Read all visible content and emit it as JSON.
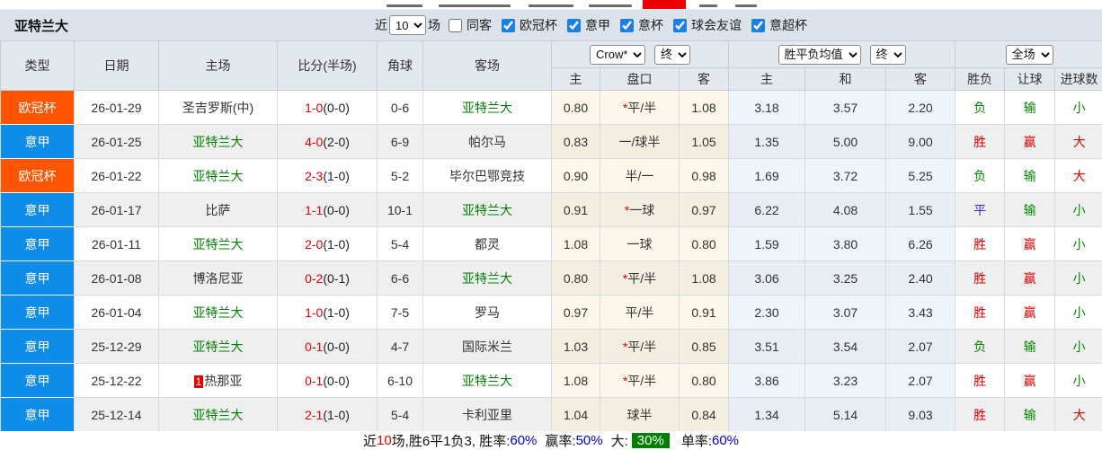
{
  "focus_team": "亚特兰大",
  "accent_colors": {
    "league_cup": "#ff5500",
    "league_serie_a": "#0d8ce8",
    "win_red": "#dd0000",
    "lose_green": "#008800",
    "draw_blue": "#2b2bd6",
    "team_green": "#008000",
    "highlight_green_bg": "#008000",
    "clipped_red_block": "#ef0000"
  },
  "toolbar": {
    "team_title": "亚特兰大",
    "recent_label": "近",
    "matches_count": "10",
    "matches_label": "场",
    "same_venue_label": "同客",
    "same_venue_checked": false,
    "filters": [
      {
        "label": "欧冠杯",
        "checked": true
      },
      {
        "label": "意甲",
        "checked": true
      },
      {
        "label": "意杯",
        "checked": true
      },
      {
        "label": "球会友谊",
        "checked": true
      },
      {
        "label": "意超杯",
        "checked": true
      }
    ]
  },
  "table": {
    "headers_left": [
      "类型",
      "日期",
      "主场",
      "比分(半场)",
      "角球",
      "客场"
    ],
    "odds_group": {
      "bookmaker": "Crow*",
      "state": "终"
    },
    "avg_group": {
      "name": "胜平负均值",
      "state": "终"
    },
    "result_group": {
      "scope": "全场"
    },
    "sub_headers": [
      "主",
      "盘口",
      "客",
      "主",
      "和",
      "客",
      "胜负",
      "让球",
      "进球数"
    ],
    "rows": [
      {
        "league": "欧冠杯",
        "date": "26-01-29",
        "home": "圣吉罗斯(中)",
        "score": "1-0",
        "half": "(0-0)",
        "corners": "0-6",
        "away": "亚特兰大",
        "odds_home": "0.80",
        "handicap_star": "*",
        "handicap": "平/半",
        "odds_away": "1.08",
        "avg_win": "3.18",
        "avg_draw": "3.57",
        "avg_lose": "2.20",
        "outcome": "负",
        "handicap_result": "输",
        "goals": "小"
      },
      {
        "league": "意甲",
        "date": "26-01-25",
        "home": "亚特兰大",
        "score": "4-0",
        "half": "(2-0)",
        "corners": "6-9",
        "away": "帕尔马",
        "odds_home": "0.83",
        "handicap": "一/球半",
        "odds_away": "1.05",
        "avg_win": "1.35",
        "avg_draw": "5.00",
        "avg_lose": "9.00",
        "outcome": "胜",
        "handicap_result": "赢",
        "goals": "大"
      },
      {
        "league": "欧冠杯",
        "date": "26-01-22",
        "home": "亚特兰大",
        "score": "2-3",
        "half": "(1-0)",
        "corners": "5-2",
        "away": "毕尔巴鄂竞技",
        "odds_home": "0.90",
        "handicap": "半/一",
        "odds_away": "0.98",
        "avg_win": "1.69",
        "avg_draw": "3.72",
        "avg_lose": "5.25",
        "outcome": "负",
        "handicap_result": "输",
        "goals": "大"
      },
      {
        "league": "意甲",
        "date": "26-01-17",
        "home": "比萨",
        "score": "1-1",
        "half": "(0-0)",
        "corners": "10-1",
        "away": "亚特兰大",
        "odds_home": "0.91",
        "handicap_star": "*",
        "handicap": "一球",
        "odds_away": "0.97",
        "avg_win": "6.22",
        "avg_draw": "4.08",
        "avg_lose": "1.55",
        "outcome": "平",
        "handicap_result": "输",
        "goals": "小"
      },
      {
        "league": "意甲",
        "date": "26-01-11",
        "home": "亚特兰大",
        "score": "2-0",
        "half": "(1-0)",
        "corners": "5-4",
        "away": "都灵",
        "odds_home": "1.08",
        "handicap": "一球",
        "odds_away": "0.80",
        "avg_win": "1.59",
        "avg_draw": "3.80",
        "avg_lose": "6.26",
        "outcome": "胜",
        "handicap_result": "赢",
        "goals": "小"
      },
      {
        "league": "意甲",
        "date": "26-01-08",
        "home": "博洛尼亚",
        "score": "0-2",
        "half": "(0-1)",
        "corners": "6-6",
        "away": "亚特兰大",
        "odds_home": "0.80",
        "handicap_star": "*",
        "handicap": "平/半",
        "odds_away": "1.08",
        "avg_win": "3.06",
        "avg_draw": "3.25",
        "avg_lose": "2.40",
        "outcome": "胜",
        "handicap_result": "赢",
        "goals": "小"
      },
      {
        "league": "意甲",
        "date": "26-01-04",
        "home": "亚特兰大",
        "score": "1-0",
        "half": "(1-0)",
        "corners": "7-5",
        "away": "罗马",
        "odds_home": "0.97",
        "handicap": "平/半",
        "odds_away": "0.91",
        "avg_win": "2.30",
        "avg_draw": "3.07",
        "avg_lose": "3.43",
        "outcome": "胜",
        "handicap_result": "赢",
        "goals": "小"
      },
      {
        "league": "意甲",
        "date": "25-12-29",
        "home": "亚特兰大",
        "score": "0-1",
        "half": "(0-0)",
        "corners": "4-7",
        "away": "国际米兰",
        "odds_home": "1.03",
        "handicap_star": "*",
        "handicap": "平/半",
        "odds_away": "0.85",
        "avg_win": "3.51",
        "avg_draw": "3.54",
        "avg_lose": "2.07",
        "outcome": "负",
        "handicap_result": "输",
        "goals": "小"
      },
      {
        "league": "意甲",
        "date": "25-12-22",
        "home": "热那亚",
        "home_badge": "1",
        "score": "0-1",
        "half": "(0-0)",
        "corners": "6-10",
        "away": "亚特兰大",
        "odds_home": "1.08",
        "handicap_star": "*",
        "handicap": "平/半",
        "odds_away": "0.80",
        "avg_win": "3.86",
        "avg_draw": "3.23",
        "avg_lose": "2.07",
        "outcome": "胜",
        "handicap_result": "赢",
        "goals": "小"
      },
      {
        "league": "意甲",
        "date": "25-12-14",
        "home": "亚特兰大",
        "score": "2-1",
        "half": "(1-0)",
        "corners": "5-4",
        "away": "卡利亚里",
        "odds_home": "1.04",
        "handicap": "球半",
        "odds_away": "0.84",
        "avg_win": "1.34",
        "avg_draw": "5.14",
        "avg_lose": "9.03",
        "outcome": "胜",
        "handicap_result": "输",
        "goals": "大"
      }
    ]
  },
  "summary": {
    "prefix": "近",
    "count": "10",
    "mid": "场,胜6平1负3, 胜率:",
    "win_rate": "60%",
    "odds_label": "赢率:",
    "odds_rate": "50%",
    "big_label": "大:",
    "big_rate": "30%",
    "single_label": "单率:",
    "single_rate": "60%"
  }
}
